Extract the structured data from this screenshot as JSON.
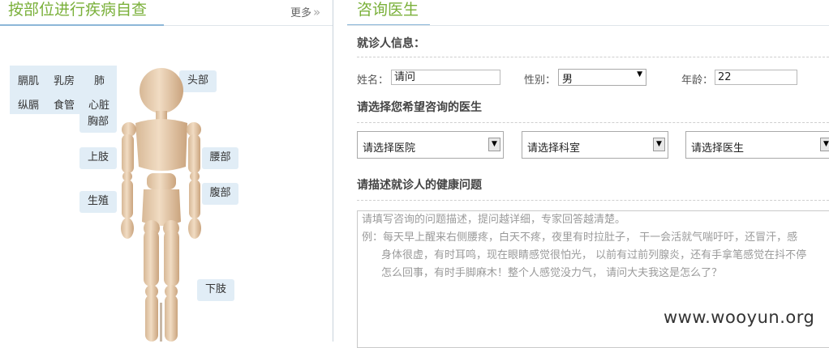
{
  "left": {
    "title": "按部位进行疾病自查",
    "more": "更多",
    "more_icon": "double-chevron-right-icon",
    "organs": [
      "膈肌",
      "乳房",
      "肺",
      "纵膈",
      "食管",
      "心脏"
    ],
    "body_parts": {
      "chest": "胸部",
      "head": "头部",
      "upper_limb": "上肢",
      "waist": "腰部",
      "abdomen": "腹部",
      "genital": "生殖",
      "lower_limb": "下肢"
    }
  },
  "right": {
    "title": "咨询医生",
    "patient_info_label": "就诊人信息：",
    "name_label": "姓名：",
    "name_value": "请问",
    "gender_label": "性别：",
    "gender_value": "男",
    "age_label": "年龄：",
    "age_value": "22",
    "doctor_section_label": "请选择您希望咨询的医生",
    "hospital_select": "请选择医院",
    "department_select": "请选择科室",
    "doctor_select": "请选择医生",
    "health_section_label": "请描述就诊人的健康问题",
    "textarea_lines": [
      "请填写咨询的问题描述，提问越详细，专家回答越清楚。",
      "例：每天早上醒来右侧腰疼，白天不疼，夜里有时拉肚子， 干一会活就气喘吁吁，还冒汗，感",
      "身体很虚，有时耳鸣，现在眼睛感觉很怕光， 以前有过前列腺炎，还有手拿笔感觉在抖不停",
      "怎么回事，有时手脚麻木！整个人感觉没力气， 请问大夫我这是怎么了？"
    ]
  },
  "watermark": "www.wooyun.org",
  "colors": {
    "title_green": "#7ab03a",
    "tag_bg": "#e1edf6",
    "tab_underline": "#8db7d8"
  }
}
